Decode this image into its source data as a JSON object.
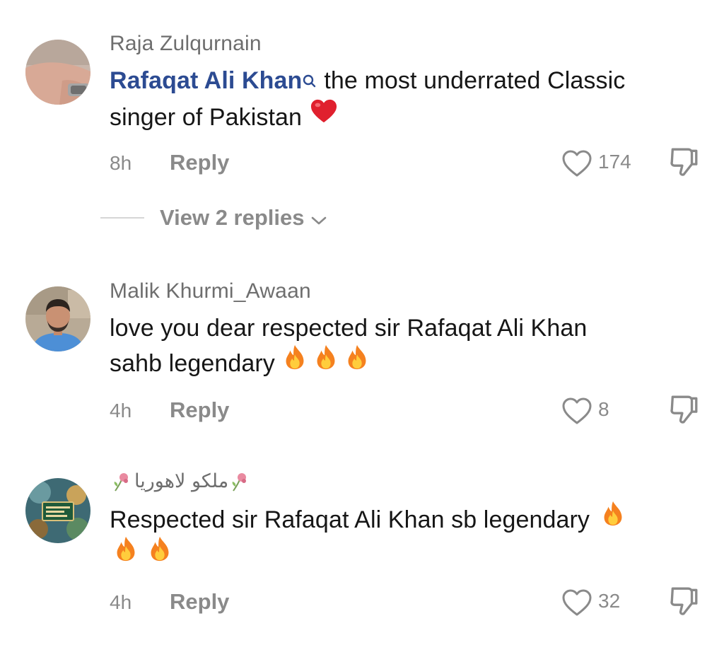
{
  "comments": [
    {
      "username": "Raja Zulqurnain",
      "mention": "Rafaqat Ali Khan",
      "text_line1": "the most underrated Classic",
      "text_line2": "singer of Pakistan",
      "time": "8h",
      "reply_label": "Reply",
      "like_count": "174"
    },
    {
      "username": "Malik Khurmi_Awaan",
      "text_line1": "love you dear respected sir Rafaqat Ali Khan",
      "text_line2": "sahb legendary",
      "time": "4h",
      "reply_label": "Reply",
      "like_count": "8"
    },
    {
      "username": "ملکو لاھوریا",
      "text_line1": "Respected sir Rafaqat Ali Khan sb legendary",
      "time": "4h",
      "reply_label": "Reply",
      "like_count": "32"
    }
  ],
  "view_replies_label": "View 2 replies",
  "icons": {
    "heart": "heart-icon",
    "dislike": "thumbs-down-icon",
    "fire": "fire-emoji",
    "red_heart": "red-heart-emoji",
    "rose": "wilted-rose-emoji",
    "chevron": "chevron-down-icon",
    "search": "search-icon"
  },
  "colors": {
    "mention": "#2c4b92",
    "muted": "#8a8a8a",
    "heart_emoji": "#e0202e"
  }
}
